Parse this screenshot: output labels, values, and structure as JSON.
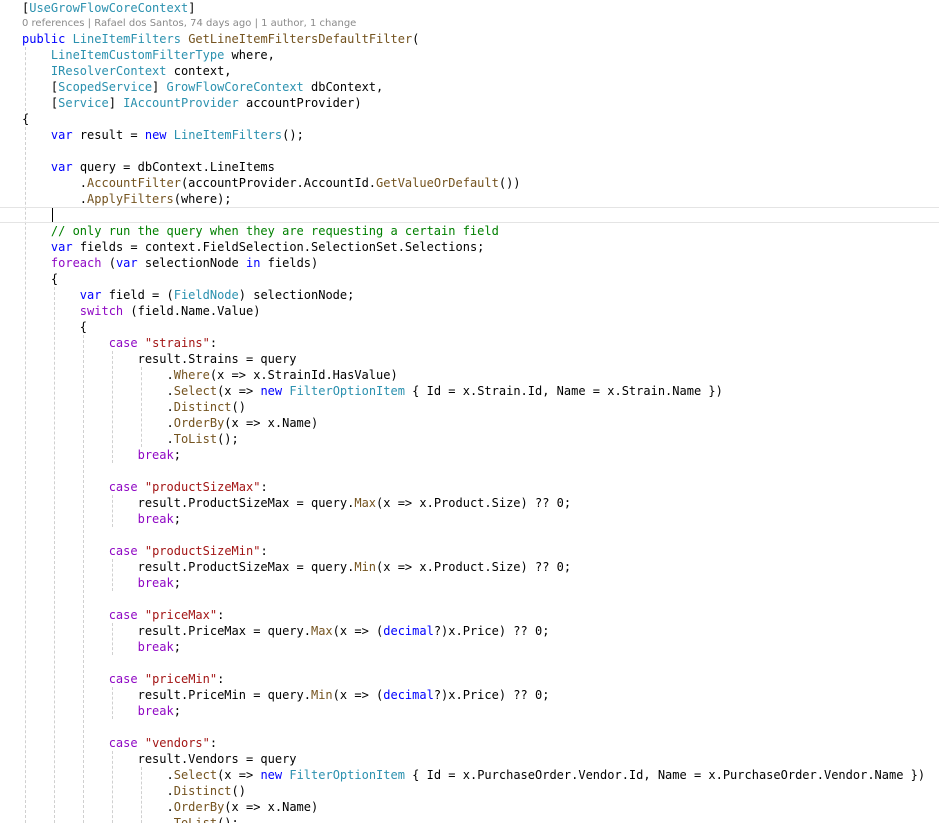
{
  "editor": {
    "codelens": "0 references | Rafael dos Santos, 74 days ago | 1 author, 1 change",
    "lines": [
      [
        [
          "[",
          "#000000"
        ],
        [
          "UseGrowFlowCoreContext",
          "#2b91af"
        ],
        [
          "]",
          "#000000"
        ]
      ],
      [
        [
          "public",
          "#0000ff"
        ],
        [
          " ",
          "#000000"
        ],
        [
          "LineItemFilters",
          "#2b91af"
        ],
        [
          " ",
          "#000000"
        ],
        [
          "GetLineItemFiltersDefaultFilter",
          "#74531f"
        ],
        [
          "(",
          "#000000"
        ]
      ],
      [
        [
          "    ",
          "#000000"
        ],
        [
          "LineItemCustomFilterType",
          "#2b91af"
        ],
        [
          " where,",
          "#000000"
        ]
      ],
      [
        [
          "    ",
          "#000000"
        ],
        [
          "IResolverContext",
          "#2b91af"
        ],
        [
          " context,",
          "#000000"
        ]
      ],
      [
        [
          "    [",
          "#000000"
        ],
        [
          "ScopedService",
          "#2b91af"
        ],
        [
          "] ",
          "#000000"
        ],
        [
          "GrowFlowCoreContext",
          "#2b91af"
        ],
        [
          " dbContext,",
          "#000000"
        ]
      ],
      [
        [
          "    [",
          "#000000"
        ],
        [
          "Service",
          "#2b91af"
        ],
        [
          "] ",
          "#000000"
        ],
        [
          "IAccountProvider",
          "#2b91af"
        ],
        [
          " accountProvider)",
          "#000000"
        ]
      ],
      [
        [
          "{",
          "#000000"
        ]
      ],
      [
        [
          "    ",
          "#000000"
        ],
        [
          "var",
          "#0000ff"
        ],
        [
          " result = ",
          "#000000"
        ],
        [
          "new",
          "#0000ff"
        ],
        [
          " ",
          "#000000"
        ],
        [
          "LineItemFilters",
          "#2b91af"
        ],
        [
          "();",
          "#000000"
        ]
      ],
      [],
      [
        [
          "    ",
          "#000000"
        ],
        [
          "var",
          "#0000ff"
        ],
        [
          " query = dbContext.LineItems",
          "#000000"
        ]
      ],
      [
        [
          "        .",
          "#000000"
        ],
        [
          "AccountFilter",
          "#74531f"
        ],
        [
          "(accountProvider.AccountId.",
          "#000000"
        ],
        [
          "GetValueOrDefault",
          "#74531f"
        ],
        [
          "())",
          "#000000"
        ]
      ],
      [
        [
          "        .",
          "#000000"
        ],
        [
          "ApplyFilters",
          "#74531f"
        ],
        [
          "(where);",
          "#000000"
        ]
      ],
      [],
      [
        [
          "    ",
          "#000000"
        ],
        [
          "// only run the query when they are requesting a certain field",
          "#008000"
        ]
      ],
      [
        [
          "    ",
          "#000000"
        ],
        [
          "var",
          "#0000ff"
        ],
        [
          " fields = context.FieldSelection.SelectionSet.Selections;",
          "#000000"
        ]
      ],
      [
        [
          "    ",
          "#000000"
        ],
        [
          "foreach",
          "#8f08c4"
        ],
        [
          " (",
          "#000000"
        ],
        [
          "var",
          "#0000ff"
        ],
        [
          " selectionNode ",
          "#000000"
        ],
        [
          "in",
          "#0000ff"
        ],
        [
          " fields)",
          "#000000"
        ]
      ],
      [
        [
          "    {",
          "#000000"
        ]
      ],
      [
        [
          "        ",
          "#000000"
        ],
        [
          "var",
          "#0000ff"
        ],
        [
          " field = (",
          "#000000"
        ],
        [
          "FieldNode",
          "#2b91af"
        ],
        [
          ") selectionNode;",
          "#000000"
        ]
      ],
      [
        [
          "        ",
          "#000000"
        ],
        [
          "switch",
          "#8f08c4"
        ],
        [
          " (field.Name.Value)",
          "#000000"
        ]
      ],
      [
        [
          "        {",
          "#000000"
        ]
      ],
      [
        [
          "            ",
          "#000000"
        ],
        [
          "case",
          "#8f08c4"
        ],
        [
          " ",
          "#000000"
        ],
        [
          "\"strains\"",
          "#a31515"
        ],
        [
          ":",
          "#000000"
        ]
      ],
      [
        [
          "                ",
          "#000000"
        ],
        [
          "result.Strains = query",
          "#000000"
        ]
      ],
      [
        [
          "                    .",
          "#000000"
        ],
        [
          "Where",
          "#74531f"
        ],
        [
          "(x => x.StrainId.HasValue)",
          "#000000"
        ]
      ],
      [
        [
          "                    .",
          "#000000"
        ],
        [
          "Select",
          "#74531f"
        ],
        [
          "(x => ",
          "#000000"
        ],
        [
          "new",
          "#0000ff"
        ],
        [
          " ",
          "#000000"
        ],
        [
          "FilterOptionItem",
          "#2b91af"
        ],
        [
          " { Id = x.Strain.Id, Name = x.Strain.Name })",
          "#000000"
        ]
      ],
      [
        [
          "                    .",
          "#000000"
        ],
        [
          "Distinct",
          "#74531f"
        ],
        [
          "()",
          "#000000"
        ]
      ],
      [
        [
          "                    .",
          "#000000"
        ],
        [
          "OrderBy",
          "#74531f"
        ],
        [
          "(x => x.Name)",
          "#000000"
        ]
      ],
      [
        [
          "                    .",
          "#000000"
        ],
        [
          "ToList",
          "#74531f"
        ],
        [
          "();",
          "#000000"
        ]
      ],
      [
        [
          "                ",
          "#000000"
        ],
        [
          "break",
          "#8f08c4"
        ],
        [
          ";",
          "#000000"
        ]
      ],
      [],
      [
        [
          "            ",
          "#000000"
        ],
        [
          "case",
          "#8f08c4"
        ],
        [
          " ",
          "#000000"
        ],
        [
          "\"productSizeMax\"",
          "#a31515"
        ],
        [
          ":",
          "#000000"
        ]
      ],
      [
        [
          "                ",
          "#000000"
        ],
        [
          "result.ProductSizeMax = query.",
          "#000000"
        ],
        [
          "Max",
          "#74531f"
        ],
        [
          "(x => x.Product.Size) ?? 0;",
          "#000000"
        ]
      ],
      [
        [
          "                ",
          "#000000"
        ],
        [
          "break",
          "#8f08c4"
        ],
        [
          ";",
          "#000000"
        ]
      ],
      [],
      [
        [
          "            ",
          "#000000"
        ],
        [
          "case",
          "#8f08c4"
        ],
        [
          " ",
          "#000000"
        ],
        [
          "\"productSizeMin\"",
          "#a31515"
        ],
        [
          ":",
          "#000000"
        ]
      ],
      [
        [
          "                ",
          "#000000"
        ],
        [
          "result.ProductSizeMax = query.",
          "#000000"
        ],
        [
          "Min",
          "#74531f"
        ],
        [
          "(x => x.Product.Size) ?? 0;",
          "#000000"
        ]
      ],
      [
        [
          "                ",
          "#000000"
        ],
        [
          "break",
          "#8f08c4"
        ],
        [
          ";",
          "#000000"
        ]
      ],
      [],
      [
        [
          "            ",
          "#000000"
        ],
        [
          "case",
          "#8f08c4"
        ],
        [
          " ",
          "#000000"
        ],
        [
          "\"priceMax\"",
          "#a31515"
        ],
        [
          ":",
          "#000000"
        ]
      ],
      [
        [
          "                ",
          "#000000"
        ],
        [
          "result.PriceMax = query.",
          "#000000"
        ],
        [
          "Max",
          "#74531f"
        ],
        [
          "(x => (",
          "#000000"
        ],
        [
          "decimal",
          "#0000ff"
        ],
        [
          "?)x.Price) ?? 0;",
          "#000000"
        ]
      ],
      [
        [
          "                ",
          "#000000"
        ],
        [
          "break",
          "#8f08c4"
        ],
        [
          ";",
          "#000000"
        ]
      ],
      [],
      [
        [
          "            ",
          "#000000"
        ],
        [
          "case",
          "#8f08c4"
        ],
        [
          " ",
          "#000000"
        ],
        [
          "\"priceMin\"",
          "#a31515"
        ],
        [
          ":",
          "#000000"
        ]
      ],
      [
        [
          "                ",
          "#000000"
        ],
        [
          "result.PriceMin = query.",
          "#000000"
        ],
        [
          "Min",
          "#74531f"
        ],
        [
          "(x => (",
          "#000000"
        ],
        [
          "decimal",
          "#0000ff"
        ],
        [
          "?)x.Price) ?? 0;",
          "#000000"
        ]
      ],
      [
        [
          "                ",
          "#000000"
        ],
        [
          "break",
          "#8f08c4"
        ],
        [
          ";",
          "#000000"
        ]
      ],
      [],
      [
        [
          "            ",
          "#000000"
        ],
        [
          "case",
          "#8f08c4"
        ],
        [
          " ",
          "#000000"
        ],
        [
          "\"vendors\"",
          "#a31515"
        ],
        [
          ":",
          "#000000"
        ]
      ],
      [
        [
          "                ",
          "#000000"
        ],
        [
          "result.Vendors = query",
          "#000000"
        ]
      ],
      [
        [
          "                    .",
          "#000000"
        ],
        [
          "Select",
          "#74531f"
        ],
        [
          "(x => ",
          "#000000"
        ],
        [
          "new",
          "#0000ff"
        ],
        [
          " ",
          "#000000"
        ],
        [
          "FilterOptionItem",
          "#2b91af"
        ],
        [
          " { Id = x.PurchaseOrder.Vendor.Id, Name = x.PurchaseOrder.Vendor.Name })",
          "#000000"
        ]
      ],
      [
        [
          "                    .",
          "#000000"
        ],
        [
          "Distinct",
          "#74531f"
        ],
        [
          "()",
          "#000000"
        ]
      ],
      [
        [
          "                    .",
          "#000000"
        ],
        [
          "OrderBy",
          "#74531f"
        ],
        [
          "(x => x.Name)",
          "#000000"
        ]
      ],
      [
        [
          "                    .",
          "#000000"
        ],
        [
          "ToList",
          "#74531f"
        ],
        [
          "();",
          "#000000"
        ]
      ]
    ]
  }
}
